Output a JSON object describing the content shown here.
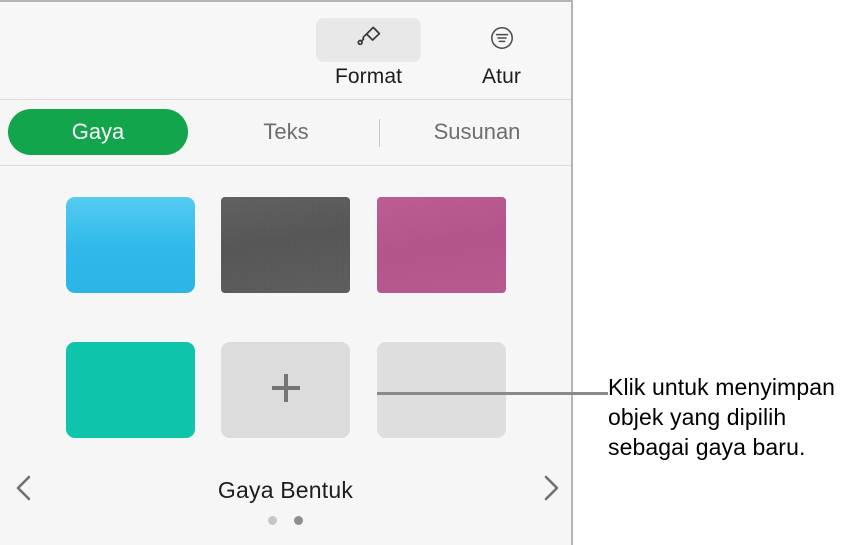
{
  "panel": {
    "toolbar": {
      "buttons": [
        {
          "id": "format",
          "label": "Format",
          "icon": "paintbrush-icon",
          "selected": true
        },
        {
          "id": "atur",
          "label": "Atur",
          "icon": "arrange-align-icon",
          "selected": false
        }
      ]
    },
    "tabs": [
      {
        "id": "gaya",
        "label": "Gaya",
        "active": true
      },
      {
        "id": "teks",
        "label": "Teks",
        "active": false
      },
      {
        "id": "susunan",
        "label": "Susunan",
        "active": false
      }
    ],
    "styles_grid": {
      "title": "Gaya Bentuk",
      "prev_icon": "chevron-left-icon",
      "next_icon": "chevron-right-icon",
      "add_icon": "plus-icon",
      "swatches": [
        {
          "id": "blue-gradient",
          "kind": "fill",
          "color": "#2fb8e9",
          "description": "blue gradient rounded rectangle"
        },
        {
          "id": "gray-texture",
          "kind": "fill",
          "color": "#585858",
          "description": "dark gray textured rectangle"
        },
        {
          "id": "pink",
          "kind": "fill",
          "color": "#b8558f",
          "description": "pink textured rectangle"
        },
        {
          "id": "teal",
          "kind": "fill",
          "color": "#0ec5ac",
          "description": "teal rounded rectangle"
        },
        {
          "id": "add-new",
          "kind": "add-button",
          "color": "#dcdcdc",
          "description": "add new style button"
        },
        {
          "id": "empty",
          "kind": "empty",
          "color": "#dedede",
          "description": "empty style placeholder"
        }
      ],
      "pagination": {
        "total": 2,
        "current": 2
      }
    }
  },
  "callout": {
    "text": "Klik untuk menyimpan objek yang dipilih sebagai gaya baru."
  },
  "colors": {
    "accent_green": "#12a54b",
    "panel_background": "#f6f6f6",
    "toolbar_background": "#f7f7f7",
    "border": "#b4b4b4",
    "divider": "#dcdcdc",
    "label_text": "#1d1d1d",
    "muted_text": "#6e6e6e",
    "callout_line": "#8a8a8a"
  }
}
